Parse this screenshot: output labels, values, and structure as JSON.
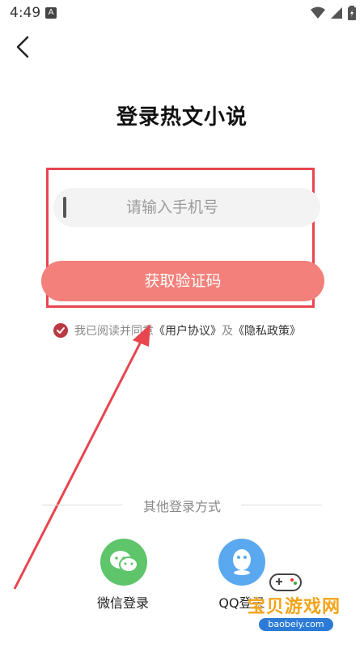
{
  "status_bar": {
    "time": "4:49",
    "notification_glyph": "A"
  },
  "header": {
    "title": "登录热文小说"
  },
  "phone_form": {
    "placeholder": "请输入手机号",
    "value": "",
    "submit_label": "获取验证码"
  },
  "agreement": {
    "checked": true,
    "prefix": "我已阅读并同意",
    "user_agreement": "《用户协议》",
    "connector": "及",
    "privacy_policy": "《隐私政策》"
  },
  "other_login": {
    "label": "其他登录方式",
    "options": [
      {
        "label": "微信登录",
        "icon": "wechat-icon",
        "color": "#5ec56b"
      },
      {
        "label": "QQ登录",
        "icon": "qq-icon",
        "color": "#5aa8f0"
      }
    ]
  },
  "watermark": {
    "title": "宝贝游戏网",
    "url": "baobeiy.com"
  },
  "colors": {
    "accent": "#f3807a",
    "highlight": "#e8454f",
    "check": "#b93a44"
  }
}
